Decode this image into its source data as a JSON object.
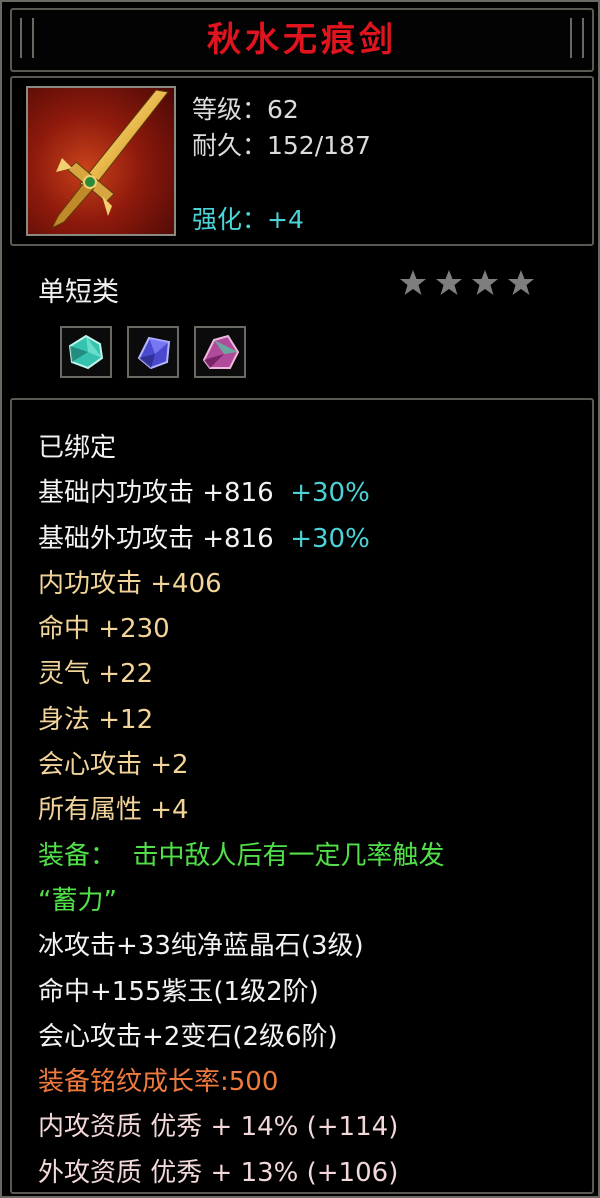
{
  "title": "秋水无痕剑",
  "info": {
    "level": "等级：62",
    "durability": "耐久：152/187",
    "enhance": "强化：+4"
  },
  "item_type": "单短类",
  "stars": {
    "count": 4,
    "color": "#7e7e7e"
  },
  "gems": [
    {
      "icon": "teal-gem-icon",
      "color": "#35c3b0"
    },
    {
      "icon": "blue-gem-icon",
      "color": "#5a5ad8"
    },
    {
      "icon": "purple-gem-icon",
      "color": "#c04aa0"
    }
  ],
  "stats": {
    "bound": "已绑定",
    "base_inner_attack": "基础内功攻击 +816",
    "base_inner_attack_bonus": "+30%",
    "base_outer_attack": "基础外功攻击 +816",
    "base_outer_attack_bonus": "+30%",
    "inner_attack": "内功攻击 +406",
    "hit": "命中 +230",
    "spirit": "灵气 +22",
    "agility": "身法 +12",
    "crit_attack": "会心攻击 +2",
    "all_attributes": "所有属性 +4",
    "equip_effect_line1": "装备：  击中敌人后有一定几率触发",
    "equip_effect_line2": "“蓄力”",
    "gem_1": "冰攻击+33纯净蓝晶石(3级)",
    "gem_2": "命中+155紫玉(1级2阶)",
    "gem_3": "会心攻击+2变石(2级6阶)",
    "inscription_growth": "装备铭纹成长率:500",
    "inner_quality": "内攻资质 优秀 + 14% (+114)",
    "outer_quality": "外攻资质 优秀 + 13% (+106)"
  },
  "colors": {
    "title": "#e0141e",
    "enhance": "#4bd3d8",
    "bonus": "#4bd3d8",
    "attribute": "#f2d49a",
    "effect": "#52e04a",
    "growth": "#ef7a3e"
  }
}
